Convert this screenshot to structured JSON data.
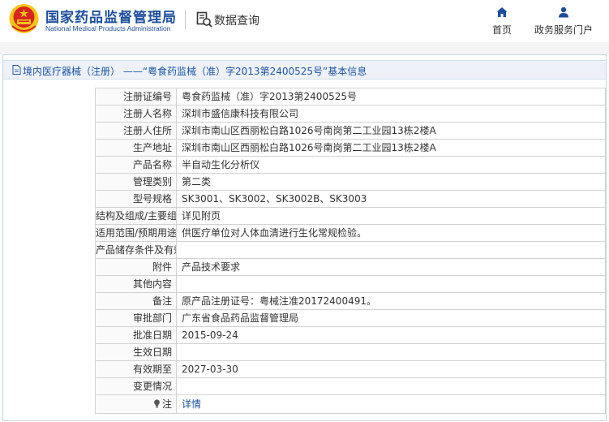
{
  "header": {
    "brand_cn": "国家药品监督管理局",
    "brand_en": "National Medical Products Administration",
    "data_query": "数据查询",
    "nav": [
      {
        "label": "首页",
        "icon": "home-icon"
      },
      {
        "label": "政务服务门户",
        "icon": "user-icon"
      }
    ]
  },
  "panel": {
    "title": "境内医疗器械（注册） ——“粤食药监械（准）字2013第2400525号”基本信息"
  },
  "rows": [
    {
      "label": "注册证编号",
      "value": "粤食药监械（准）字2013第2400525号"
    },
    {
      "label": "注册人名称",
      "value": "深圳市盛信康科技有限公司"
    },
    {
      "label": "注册人住所",
      "value": "深圳市南山区西丽松白路1026号南岗第二工业园13栋2楼A"
    },
    {
      "label": "生产地址",
      "value": "深圳市南山区西丽松白路1026号南岗第二工业园13栋2楼A"
    },
    {
      "label": "产品名称",
      "value": "半自动生化分析仪"
    },
    {
      "label": "管理类别",
      "value": "第二类"
    },
    {
      "label": "型号规格",
      "value": "SK3001、SK3002、SK3002B、SK3003"
    },
    {
      "label": "结构及组成/主要组成成分",
      "value": "详见附页"
    },
    {
      "label": "适用范围/预期用途",
      "value": "供医疗单位对人体血清进行生化常规检验。"
    },
    {
      "label": "产品储存条件及有效期",
      "value": ""
    },
    {
      "label": "附件",
      "value": "产品技术要求"
    },
    {
      "label": "其他内容",
      "value": ""
    },
    {
      "label": "备注",
      "value": "原产品注册证号：粤械注准20172400491。"
    },
    {
      "label": "审批部门",
      "value": "广东省食品药品监督管理局"
    },
    {
      "label": "批准日期",
      "value": "2015-09-24"
    },
    {
      "label": "生效日期",
      "value": ""
    },
    {
      "label": "有效期至",
      "value": "2027-03-30"
    },
    {
      "label": "变更情况",
      "value": ""
    }
  ],
  "note_row": {
    "label": "注",
    "link": "详情"
  },
  "colors": {
    "brand_blue": "#1e4f9c",
    "link_blue": "#1a54a3",
    "emblem_red": "#d7261e",
    "emblem_gold": "#f5c518"
  }
}
